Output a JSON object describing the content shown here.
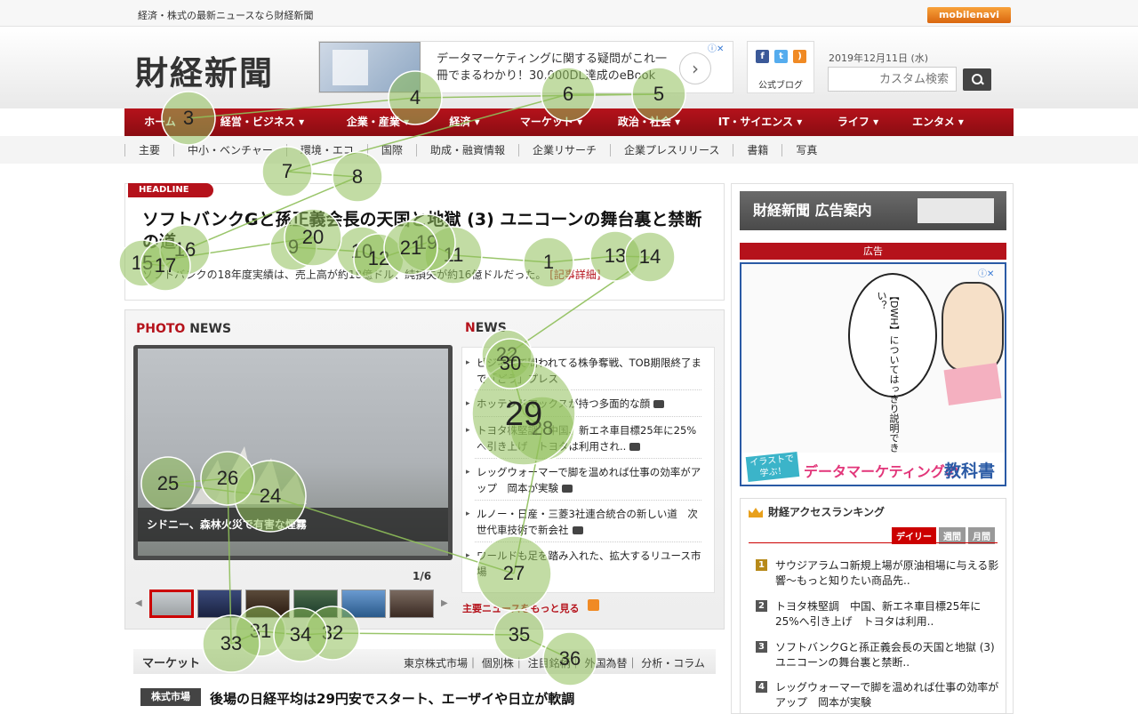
{
  "topbar": {
    "tagline": "経済・株式の最新ニュースなら財経新聞",
    "mobile_link": "mobilenavi"
  },
  "header": {
    "logo": "財経新聞",
    "ad_text": "データマーケティングに関する疑問がこれ一冊でまるわかり！30,000DL達成のeBook",
    "ad_arrow_icon": "chevron-right-icon",
    "ad_choices": "ⓘ✕",
    "social_label": "公式ブログ",
    "date": "2019年12月11日 (水)",
    "search_placeholder": "カスタム検索"
  },
  "main_nav": [
    "ホーム",
    "経営・ビジネス ▾",
    "企業・産業 ▾",
    "経済 ▾",
    "マーケット ▾",
    "政治・社会 ▾",
    "IT・サイエンス ▾",
    "ライフ ▾",
    "エンタメ ▾"
  ],
  "sub_nav": [
    "主要",
    "中小・ベンチャー",
    "環境・エコ",
    "国際",
    "助成・融資情報",
    "企業リサーチ",
    "企業プレスリリース",
    "書籍",
    "写真"
  ],
  "headline": {
    "badge": "HEADLINE",
    "title": "ソフトバンクGと孫正義会長の天国と地獄 (3) ユニコーンの舞台裏と禁断の道",
    "lead": "ソフトバンクの18年度実績は、売上高が約18億ドル、純損失が約16億ドルだった。",
    "more": "[記事詳細]"
  },
  "photo_news": {
    "title_red": "PHOTO",
    "title_rest": " NEWS",
    "caption": "シドニー、森林火災で有害な煙霧",
    "pager": "1/6",
    "prev_icon": "◀",
    "next_icon": "▶"
  },
  "news": {
    "title_red": "N",
    "title_rest": "EWS",
    "items": [
      "ビジネスで問われてる株争奪戦、TOB期限終了まで「どう」プレス",
      "ホッテンドマックスが持つ多面的な顔",
      "トヨタ株堅調　中国、新エネ車目標25年に25%へ引き上げ　トヨタは利用され..",
      "レッグウォーマーで脚を温めれば仕事の効率がアップ　岡本が実験",
      "ルノー・日産・三菱3社連合統合の新しい道　次世代車技術で新会社",
      "ワールドも足を踏み入れた、拡大するリユース市場"
    ],
    "more": "主要ニュースをもっと見る"
  },
  "market": {
    "title": "マーケット",
    "tabs": "東京株式市場｜ 個別株｜ 注目銘柄｜ 外国為替｜ 分析・コラム",
    "badge": "株式市場",
    "headline": "後場の日経平均は29円安でスタート、エーザイや日立が軟調"
  },
  "sidebar": {
    "ad_guide": "財経新聞 広告案内",
    "ad_label": "広告",
    "side_ad": {
      "bubble_text": "【DWH】についてはっきり説明できるかい？",
      "tag1": "イラストで学ぶ！",
      "tag2": "データマーケティングの",
      "tag3": "教科書",
      "choices": "ⓘ✕"
    },
    "ranking_title": "財経アクセスランキング",
    "ranking_tabs": [
      "デイリー",
      "週間",
      "月間"
    ],
    "ranking": [
      {
        "num": "1",
        "text": "サウジアラムコ新規上場が原油相場に与える影響〜もっと知りたい商品先.."
      },
      {
        "num": "2",
        "text": "トヨタ株堅調　中国、新エネ車目標25年に25%へ引き上げ　トヨタは利用.."
      },
      {
        "num": "3",
        "text": "ソフトバンクGと孫正義会長の天国と地獄 (3) ユニコーンの舞台裏と禁断.."
      },
      {
        "num": "4",
        "text": "レッグウォーマーで脚を温めれば仕事の効率がアップ　岡本が実験"
      }
    ]
  },
  "gaze": {
    "color": "#8fbf5a",
    "fixations": [
      {
        "n": "1"
      },
      {
        "n": "3"
      },
      {
        "n": "4"
      },
      {
        "n": "5"
      },
      {
        "n": "6"
      },
      {
        "n": "7"
      },
      {
        "n": "8"
      },
      {
        "n": "9"
      },
      {
        "n": "10"
      },
      {
        "n": "11"
      },
      {
        "n": "12"
      },
      {
        "n": "13"
      },
      {
        "n": "14"
      },
      {
        "n": "15"
      },
      {
        "n": "16"
      },
      {
        "n": "17"
      },
      {
        "n": "19"
      },
      {
        "n": "20"
      },
      {
        "n": "21"
      },
      {
        "n": "22"
      },
      {
        "n": "24"
      },
      {
        "n": "25"
      },
      {
        "n": "26"
      },
      {
        "n": "27"
      },
      {
        "n": "28"
      },
      {
        "n": "29"
      },
      {
        "n": "30"
      },
      {
        "n": "31"
      },
      {
        "n": "32"
      },
      {
        "n": "33"
      },
      {
        "n": "34"
      },
      {
        "n": "35"
      },
      {
        "n": "36"
      }
    ]
  }
}
